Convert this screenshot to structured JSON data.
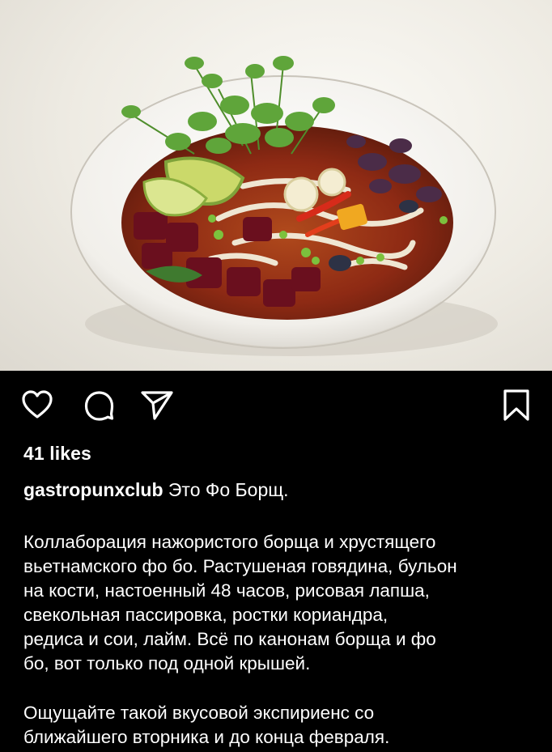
{
  "post": {
    "image_description_icon": "borscht-pho-bowl-photo",
    "actions": {
      "like_icon": "heart-icon",
      "comment_icon": "comment-icon",
      "share_icon": "send-icon",
      "save_icon": "bookmark-icon"
    },
    "likes": "41 likes",
    "username": "gastropunxclub",
    "caption_intro": " Это Фо Борщ.",
    "paragraph1": "Коллаборация нажористого борща и хрустящего\nвьетнамского фо бо. Растушеная говядина, бульон\nна кости, настоенный 48 часов, рисовая лапша,\nсвекольная пассировка, ростки кориандра,\nредиса и сои, лайм. Всё по канонам борща и фо\nбо, вот только под одной крышей.",
    "paragraph2": "Ощущайте такой вкусовой экспириенс со\nближайшего вторника и до конца февраля."
  }
}
